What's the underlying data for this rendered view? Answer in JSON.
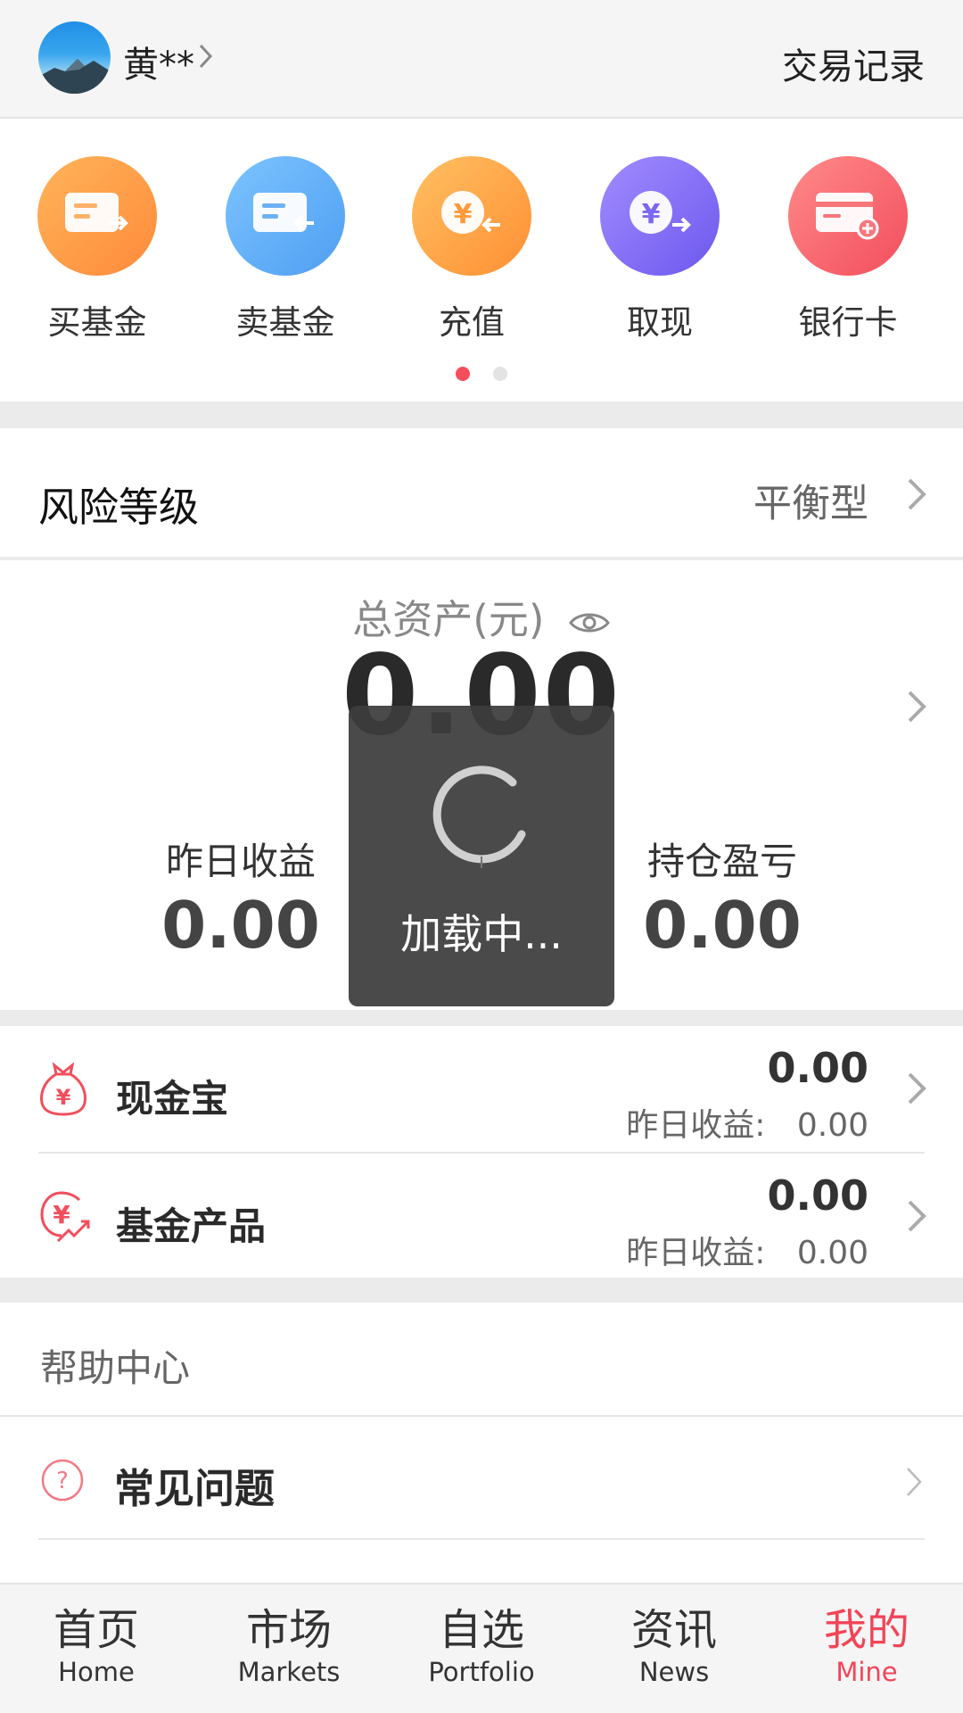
{
  "header": {
    "username": "黄**",
    "trade_record": "交易记录"
  },
  "quick_actions": [
    {
      "label": "买基金",
      "icon": "buy-fund-icon",
      "color": "#ff9a3c"
    },
    {
      "label": "卖基金",
      "icon": "sell-fund-icon",
      "color": "#58aef7"
    },
    {
      "label": "充值",
      "icon": "recharge-icon",
      "color": "#ffa03b"
    },
    {
      "label": "取现",
      "icon": "withdraw-icon",
      "color": "#7d6cf0"
    },
    {
      "label": "银行卡",
      "icon": "bank-card-icon",
      "color": "#f6646b"
    }
  ],
  "pagination": {
    "pages": 2,
    "active": 1
  },
  "risk": {
    "title": "风险等级",
    "value": "平衡型"
  },
  "assets": {
    "title": "总资产(元)",
    "total": "0.00",
    "yesterday_label": "昨日收益",
    "yesterday_value": "0.00",
    "holding_label": "持仓盈亏",
    "holding_value": "0.00"
  },
  "products": [
    {
      "name": "现金宝",
      "icon": "money-bag-icon",
      "amount": "0.00",
      "sub_label": "昨日收益:",
      "sub_value": "0.00"
    },
    {
      "name": "基金产品",
      "icon": "fund-yen-icon",
      "amount": "0.00",
      "sub_label": "昨日收益:",
      "sub_value": "0.00"
    }
  ],
  "help": {
    "title": "帮助中心",
    "faq": "常见问题"
  },
  "loading": {
    "text": "加载中..."
  },
  "nav": [
    {
      "cn": "首页",
      "en": "Home",
      "active": false
    },
    {
      "cn": "市场",
      "en": "Markets",
      "active": false
    },
    {
      "cn": "自选",
      "en": "Portfolio",
      "active": false
    },
    {
      "cn": "资讯",
      "en": "News",
      "active": false
    },
    {
      "cn": "我的",
      "en": "Mine",
      "active": true
    }
  ],
  "colors": {
    "accent": "#f24457",
    "section_gap": "#ebebeb"
  }
}
